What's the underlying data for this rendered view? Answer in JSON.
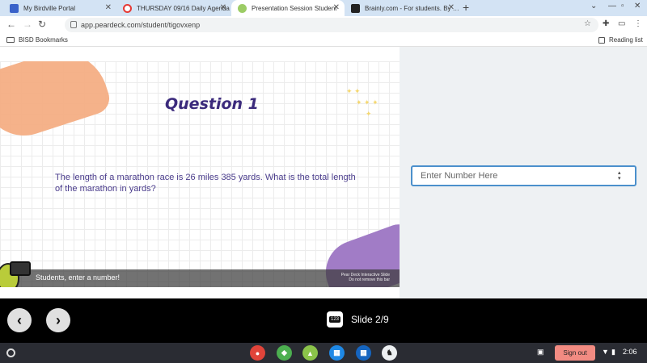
{
  "browser": {
    "tabs": [
      {
        "title": "My Birdville Portal",
        "color": "#3a62c9"
      },
      {
        "title": "THURSDAY 09/16 Daily Agenda",
        "color": "#e53935"
      },
      {
        "title": "Presentation Session Student",
        "color": "#9ccc65"
      },
      {
        "title": "Brainly.com - For students. By stu",
        "color": "#222222"
      }
    ],
    "new_tab": "+",
    "url": "app.peardeck.com/student/tigovxenp",
    "bookmarks": {
      "folder": "BISD Bookmarks",
      "reading_list": "Reading list"
    }
  },
  "slide": {
    "title": "Question 1",
    "question": "The length of a marathon race is 26 miles 385 yards.  What is the total length of the marathon in yards?",
    "prompt": "Students, enter a number!",
    "watermark_line1": "Pear Deck Interactive Slide",
    "watermark_line2": "Do not remove this bar"
  },
  "answer": {
    "placeholder": "Enter Number Here"
  },
  "player": {
    "prev": "‹",
    "next": "›",
    "slide_badge": "123",
    "slide_label": "Slide 2/9"
  },
  "shelf": {
    "apps": [
      {
        "name": "chrome",
        "color": "#e0443a",
        "glyph": "●"
      },
      {
        "name": "app2",
        "color": "#4caf50",
        "glyph": "◆"
      },
      {
        "name": "app3",
        "color": "#8bc34a",
        "glyph": "▲"
      },
      {
        "name": "app4",
        "color": "#1e88e5",
        "glyph": "▦"
      },
      {
        "name": "app5",
        "color": "#1565c0",
        "glyph": "▦"
      },
      {
        "name": "app6",
        "color": "#eceff1",
        "glyph": "♞"
      }
    ],
    "sign_out": "Sign out",
    "time": "2:06"
  }
}
